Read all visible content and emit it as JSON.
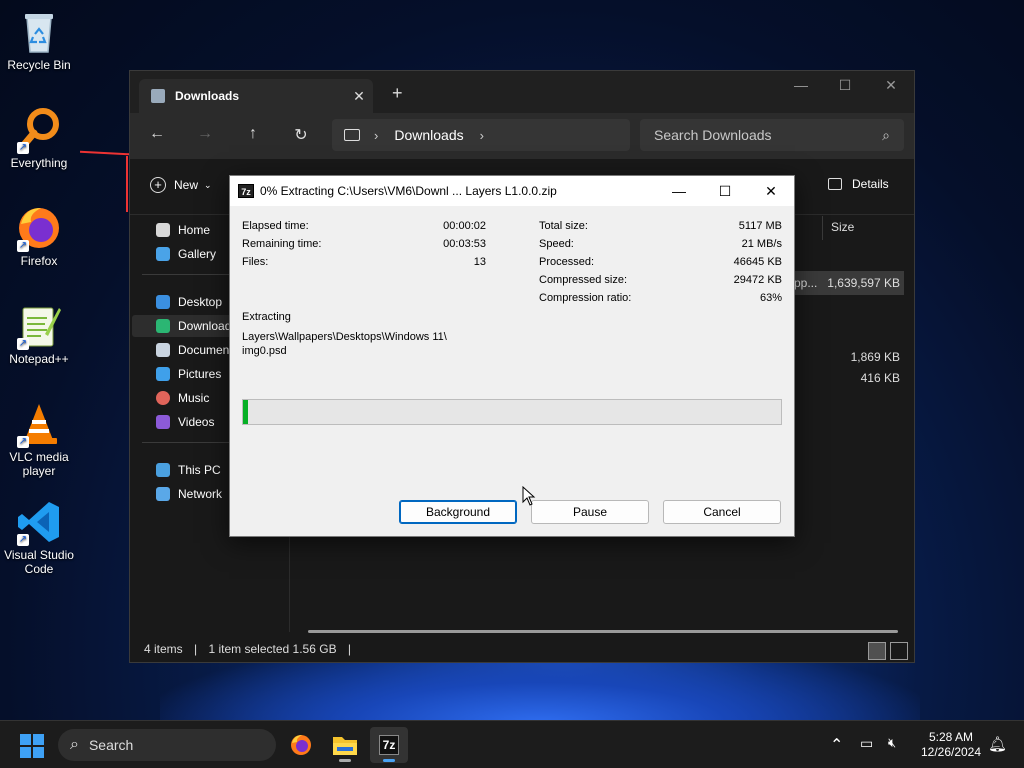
{
  "desktop": {
    "icons": [
      {
        "label": "Recycle Bin"
      },
      {
        "label": "Everything"
      },
      {
        "label": "Firefox"
      },
      {
        "label": "Notepad++"
      },
      {
        "label": "VLC media player"
      },
      {
        "label": "Visual Studio Code"
      }
    ]
  },
  "explorer": {
    "tab_title": "Downloads",
    "tab_close": "✕",
    "new_tab": "+",
    "address": {
      "location": "Downloads"
    },
    "search_placeholder": "Search Downloads",
    "cmd_new": "New",
    "cmd_details": "Details",
    "sidebar": {
      "items": [
        "Home",
        "Gallery",
        "Desktop",
        "Downloads",
        "Documents",
        "Pictures",
        "Music",
        "Videos",
        "This PC",
        "Network"
      ]
    },
    "column_size": "Size",
    "files": [
      {
        "name_fragment": "pp...",
        "size": "1,639,597 KB"
      },
      {
        "size": "1,869 KB"
      },
      {
        "size": "416 KB"
      }
    ],
    "status": {
      "items": "4 items",
      "selected": "1 item selected  1.56 GB",
      "sep": "|"
    }
  },
  "dialog": {
    "title": "0% Extracting C:\\Users\\VM6\\Downl ...  Layers L1.0.0.zip",
    "app_icon_text": "7z",
    "left_stats": [
      {
        "label": "Elapsed time:",
        "value": "00:00:02"
      },
      {
        "label": "Remaining time:",
        "value": "00:03:53"
      },
      {
        "label": "Files:",
        "value": "13"
      }
    ],
    "right_stats": [
      {
        "label": "Total size:",
        "value": "5117 MB"
      },
      {
        "label": "Speed:",
        "value": "21 MB/s"
      },
      {
        "label": "Processed:",
        "value": "46645 KB"
      },
      {
        "label": "Compressed size:",
        "value": "29472 KB"
      },
      {
        "label": "Compression ratio:",
        "value": "63%"
      }
    ],
    "operation": "Extracting",
    "current_path_line1": "Layers\\Wallpapers\\Desktops\\Windows 11\\",
    "current_path_line2": "img0.psd",
    "progress_fraction": 0.01,
    "buttons": {
      "background": "Background",
      "pause": "Pause",
      "cancel": "Cancel"
    },
    "progress_color": "#06b025"
  },
  "taskbar": {
    "search_label": "Search",
    "app_7z_text": "7z",
    "time": "5:28 AM",
    "date": "12/26/2024"
  }
}
